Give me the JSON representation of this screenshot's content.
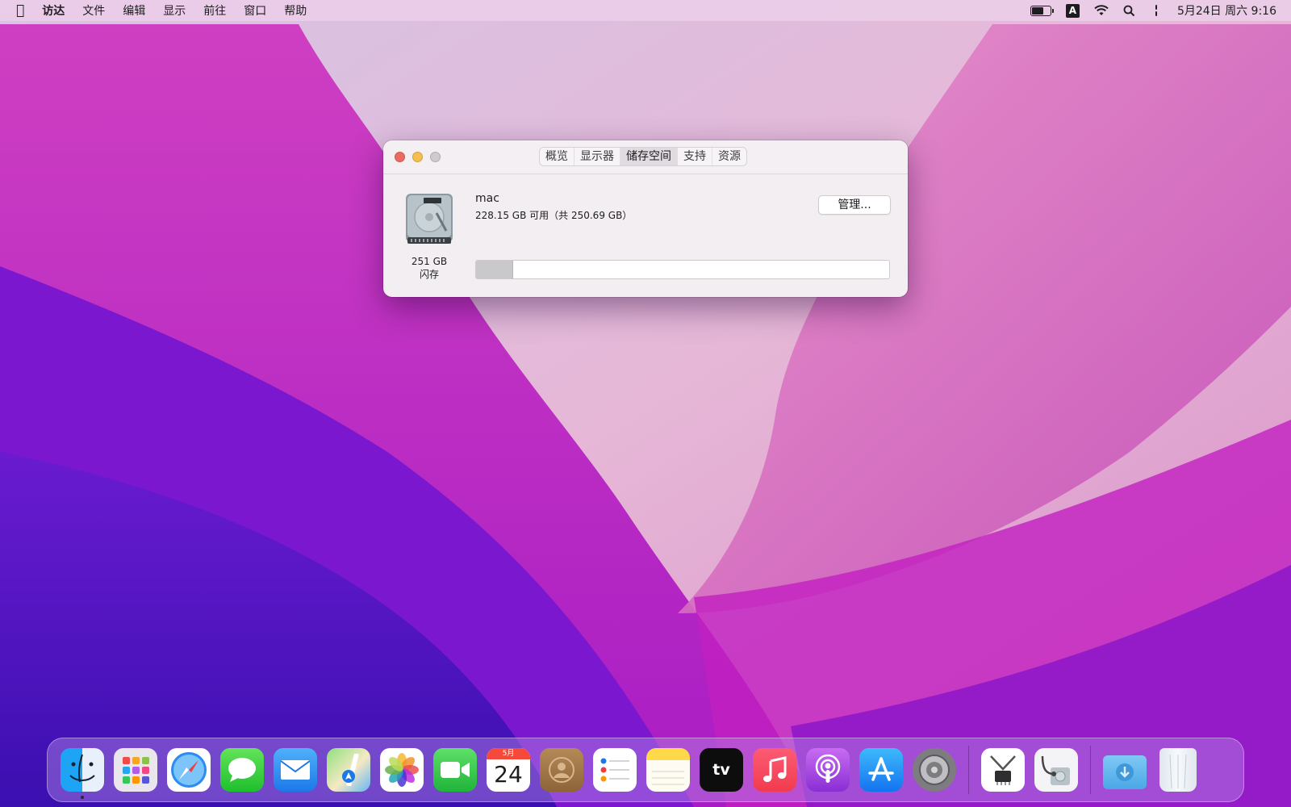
{
  "menubar": {
    "app_name": "访达",
    "menus": [
      "文件",
      "编辑",
      "显示",
      "前往",
      "窗口",
      "帮助"
    ],
    "input_source": "A",
    "clock": "5月24日 周六  9:16"
  },
  "window": {
    "tabs": [
      "概览",
      "显示器",
      "储存空间",
      "支持",
      "资源"
    ],
    "active_tab": "储存空间",
    "disk": {
      "capacity": "251 GB",
      "type": "闪存"
    },
    "volume": {
      "name": "mac",
      "free_text": "228.15 GB 可用（共 250.69 GB）",
      "used_fraction": 0.09
    },
    "manage_button": "管理..."
  },
  "dock": {
    "apps": [
      "finder",
      "launchpad",
      "safari",
      "messages",
      "mail",
      "maps",
      "photos",
      "facetime",
      "calendar",
      "contacts",
      "reminders",
      "notes",
      "tv",
      "music",
      "podcasts",
      "app-store",
      "system-preferences",
      "system-information",
      "disk-utility",
      "downloads",
      "trash"
    ],
    "calendar": {
      "month": "5月",
      "day": "24"
    },
    "tv_label": "tv"
  },
  "colors": {
    "close": "#ed6a5e",
    "minimize": "#f5be4f",
    "zoom_disabled": "#cfcacf",
    "storage_used": "#c9c9cb"
  }
}
